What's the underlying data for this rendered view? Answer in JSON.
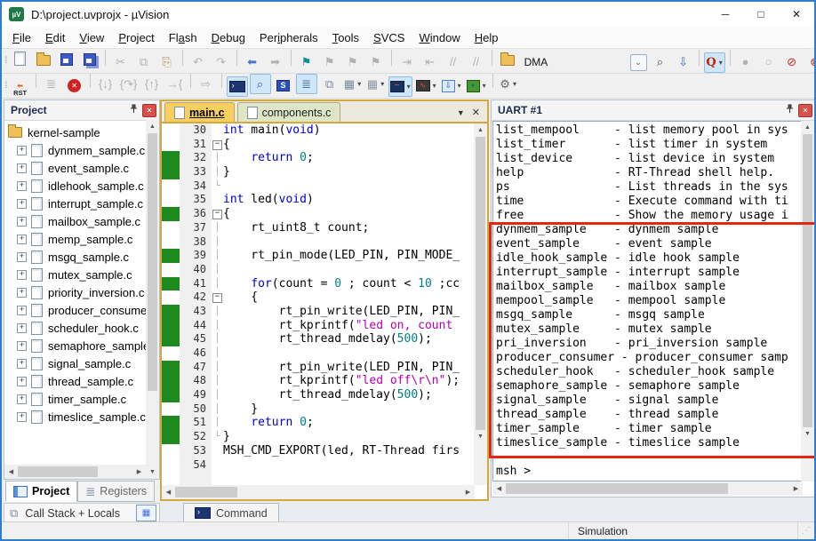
{
  "colors": {
    "window_border": "#2e7dd1",
    "active_tab": "#f6cf5e",
    "inactive_tab": "#dfe6c8",
    "change_bar_green": "#1e8a1e",
    "keyword_blue": "#0000cd",
    "number_teal": "#008080",
    "string_magenta": "#b400b4",
    "annotation_red": "#e62519",
    "close_button_red": "#d8504a",
    "toolbar_highlight": "#cfe6f9"
  },
  "window": {
    "title": "D:\\project.uvprojx - µVision",
    "minimize": "─",
    "maximize": "□",
    "close": "✕",
    "icon_text": "µV"
  },
  "menus": [
    {
      "label": "File",
      "u": 0
    },
    {
      "label": "Edit",
      "u": 0
    },
    {
      "label": "View",
      "u": 0
    },
    {
      "label": "Project",
      "u": 0
    },
    {
      "label": "Flash",
      "u": 2
    },
    {
      "label": "Debug",
      "u": 0
    },
    {
      "label": "Peripherals",
      "u": 3
    },
    {
      "label": "Tools",
      "u": 0
    },
    {
      "label": "SVCS",
      "u": 0
    },
    {
      "label": "Window",
      "u": 0
    },
    {
      "label": "Help",
      "u": 0
    }
  ],
  "toolbar1": [
    {
      "n": "new-file-button",
      "k": "page"
    },
    {
      "n": "open-file-button",
      "k": "folder"
    },
    {
      "n": "save-button",
      "k": "disk"
    },
    {
      "n": "save-all-button",
      "k": "disk2"
    },
    {
      "sep": true
    },
    {
      "n": "cut-button",
      "g": "✂",
      "dim": 1
    },
    {
      "n": "copy-button",
      "g": "⧉",
      "dim": 1
    },
    {
      "n": "paste-button",
      "g": "⎘",
      "c": "#b08d4a"
    },
    {
      "sep": true
    },
    {
      "n": "undo-button",
      "g": "↶",
      "dim": 1
    },
    {
      "n": "redo-button",
      "g": "↷",
      "dim": 1
    },
    {
      "sep": true
    },
    {
      "n": "navigate-back-button",
      "g": "⬅",
      "c": "#4a78c8"
    },
    {
      "n": "navigate-forward-button",
      "g": "➡",
      "dim": 1
    },
    {
      "sep": true
    },
    {
      "n": "toggle-bookmark-button",
      "g": "⚑",
      "c": "#0e8f9a"
    },
    {
      "n": "next-bookmark-button",
      "g": "⚑",
      "dim": 1
    },
    {
      "n": "prev-bookmark-button",
      "g": "⚑",
      "dim": 1
    },
    {
      "n": "clear-bookmarks-button",
      "g": "⚑",
      "dim": 1
    },
    {
      "sep": true
    },
    {
      "n": "indent-button",
      "g": "⇥",
      "dim": 1
    },
    {
      "n": "outdent-button",
      "g": "⇤",
      "dim": 1
    },
    {
      "n": "comment-button",
      "g": "//",
      "dim": 1
    },
    {
      "n": "uncomment-button",
      "g": "//",
      "dim": 1
    },
    {
      "sep": true
    },
    {
      "n": "configure-target-button",
      "k": "folder"
    },
    {
      "combo": "DMA",
      "n": "target-select"
    },
    {
      "n": "find-in-files-button",
      "g": "⌕",
      "c": "#444444"
    },
    {
      "n": "incremental-find-button",
      "g": "⇩",
      "c": "#3a6fd8"
    },
    {
      "sep": true
    },
    {
      "n": "quick-find-button",
      "k": "qicon",
      "g": "Q",
      "on": 1,
      "dd": 1
    },
    {
      "sep": true
    },
    {
      "n": "insert-breakpoint-button",
      "g": "●",
      "dim": 1
    },
    {
      "n": "disable-breakpoint-button",
      "g": "○",
      "dim": 1
    },
    {
      "n": "disable-all-breakpoints-button",
      "g": "⊘",
      "c": "#cc2222"
    },
    {
      "n": "kill-all-breakpoints-button",
      "g": "⊗",
      "c": "#cc2222"
    },
    {
      "sep": true
    },
    {
      "n": "periodic-window-update-button",
      "k": "winicon",
      "on": 1
    }
  ],
  "toolbar2": [
    {
      "n": "reset-button",
      "k": "rst",
      "g": "RST"
    },
    {
      "sep": true
    },
    {
      "n": "flash-download-button",
      "g": "≣",
      "dim": 1
    },
    {
      "n": "stop-debug-button",
      "k": "stop"
    },
    {
      "sep": true
    },
    {
      "n": "step-into-button",
      "g": "{↓}",
      "dim": 1
    },
    {
      "n": "step-over-button",
      "g": "{↷}",
      "dim": 1
    },
    {
      "n": "step-out-button",
      "g": "{↑}",
      "dim": 1
    },
    {
      "n": "run-to-cursor-button",
      "g": "→{",
      "dim": 1
    },
    {
      "sep": true
    },
    {
      "n": "show-next-statement-button",
      "g": "⇨",
      "dim": 1
    },
    {
      "sep": true
    },
    {
      "n": "command-window-button",
      "k": "console",
      "on": 1
    },
    {
      "n": "disassembly-window-button",
      "g": "⌕",
      "c": "#2255aa",
      "on": 1
    },
    {
      "n": "symbol-window-button",
      "k": "sbox",
      "g": "S"
    },
    {
      "n": "registers-window-button",
      "g": "≣",
      "c": "#4a6fa5",
      "on": 1
    },
    {
      "n": "call-stack-window-button",
      "g": "⧉",
      "c": "#7a8aa0"
    },
    {
      "n": "watch-window-button",
      "g": "▦",
      "c": "#7a8aa0",
      "dd": 1
    },
    {
      "n": "memory-window-button",
      "g": "▦",
      "c": "#8a97a8",
      "dd": 1
    },
    {
      "n": "serial-window-button",
      "k": "serial",
      "on": 1,
      "dd": 1
    },
    {
      "n": "analysis-window-button",
      "k": "analyzer",
      "dd": 1
    },
    {
      "n": "system-viewer-button",
      "k": "sysview",
      "dd": 1
    },
    {
      "n": "toolbox-button",
      "k": "board",
      "dd": 1
    },
    {
      "sep": true
    },
    {
      "n": "tools-button",
      "g": "⚙",
      "c": "#666666",
      "dd": 1
    }
  ],
  "project_panel": {
    "title": "Project",
    "tree": [
      {
        "label": "kernel-sample",
        "type": "folder"
      },
      {
        "label": "dynmem_sample.c",
        "type": "file"
      },
      {
        "label": "event_sample.c",
        "type": "file"
      },
      {
        "label": "idlehook_sample.c",
        "type": "file"
      },
      {
        "label": "interrupt_sample.c",
        "type": "file"
      },
      {
        "label": "mailbox_sample.c",
        "type": "file"
      },
      {
        "label": "memp_sample.c",
        "type": "file"
      },
      {
        "label": "msgq_sample.c",
        "type": "file"
      },
      {
        "label": "mutex_sample.c",
        "type": "file"
      },
      {
        "label": "priority_inversion.c",
        "type": "file"
      },
      {
        "label": "producer_consumer.c",
        "type": "file"
      },
      {
        "label": "scheduler_hook.c",
        "type": "file"
      },
      {
        "label": "semaphore_sample.c",
        "type": "file"
      },
      {
        "label": "signal_sample.c",
        "type": "file"
      },
      {
        "label": "thread_sample.c",
        "type": "file"
      },
      {
        "label": "timer_sample.c",
        "type": "file"
      },
      {
        "label": "timeslice_sample.c",
        "type": "file"
      }
    ]
  },
  "editor": {
    "tabs": [
      {
        "label": "main.c"
      },
      {
        "label": "components.c"
      }
    ],
    "lines": [
      {
        "n": 30,
        "g": "",
        "m": 0,
        "t": [
          [
            "k",
            "int"
          ],
          [
            "p",
            " main("
          ],
          [
            "k",
            "void"
          ],
          [
            "p",
            ")"
          ]
        ]
      },
      {
        "n": 31,
        "g": "-",
        "m": 0,
        "t": [
          [
            "p",
            "{"
          ]
        ]
      },
      {
        "n": 32,
        "g": "|",
        "m": 1,
        "t": [
          [
            "p",
            "    "
          ],
          [
            "k",
            "return"
          ],
          [
            "p",
            " "
          ],
          [
            "n",
            "0"
          ],
          [
            "p",
            ";"
          ]
        ]
      },
      {
        "n": 33,
        "g": "|",
        "m": 1,
        "t": [
          [
            "p",
            "}"
          ]
        ]
      },
      {
        "n": 34,
        "g": "L",
        "m": 0,
        "t": []
      },
      {
        "n": 35,
        "g": "",
        "m": 0,
        "t": [
          [
            "k",
            "int"
          ],
          [
            "p",
            " led("
          ],
          [
            "k",
            "void"
          ],
          [
            "p",
            ")"
          ]
        ]
      },
      {
        "n": 36,
        "g": "-",
        "m": 1,
        "t": [
          [
            "p",
            "{"
          ]
        ]
      },
      {
        "n": 37,
        "g": "|",
        "m": 0,
        "t": [
          [
            "p",
            "    rt_uint8_t count;"
          ]
        ]
      },
      {
        "n": 38,
        "g": "|",
        "m": 0,
        "t": []
      },
      {
        "n": 39,
        "g": "|",
        "m": 1,
        "t": [
          [
            "p",
            "    rt_pin_mode(LED_PIN, PIN_MODE_"
          ]
        ]
      },
      {
        "n": 40,
        "g": "|",
        "m": 0,
        "t": []
      },
      {
        "n": 41,
        "g": "|",
        "m": 1,
        "t": [
          [
            "p",
            "    "
          ],
          [
            "k",
            "for"
          ],
          [
            "p",
            "(count = "
          ],
          [
            "n",
            "0"
          ],
          [
            "p",
            " ; count < "
          ],
          [
            "n",
            "10"
          ],
          [
            "p",
            " ;cc"
          ]
        ]
      },
      {
        "n": 42,
        "g": "-",
        "m": 0,
        "t": [
          [
            "p",
            "    {"
          ]
        ]
      },
      {
        "n": 43,
        "g": "|",
        "m": 1,
        "t": [
          [
            "p",
            "        rt_pin_write(LED_PIN, PIN_"
          ]
        ]
      },
      {
        "n": 44,
        "g": "|",
        "m": 1,
        "t": [
          [
            "p",
            "        rt_kprintf("
          ],
          [
            "s",
            "\"led on, count"
          ]
        ]
      },
      {
        "n": 45,
        "g": "|",
        "m": 1,
        "t": [
          [
            "p",
            "        rt_thread_mdelay("
          ],
          [
            "n",
            "500"
          ],
          [
            "p",
            ");"
          ]
        ]
      },
      {
        "n": 46,
        "g": "|",
        "m": 0,
        "t": []
      },
      {
        "n": 47,
        "g": "|",
        "m": 1,
        "t": [
          [
            "p",
            "        rt_pin_write(LED_PIN, PIN_"
          ]
        ]
      },
      {
        "n": 48,
        "g": "|",
        "m": 1,
        "t": [
          [
            "p",
            "        rt_kprintf("
          ],
          [
            "s",
            "\"led off\\r\\n\""
          ],
          [
            "p",
            ");"
          ]
        ]
      },
      {
        "n": 49,
        "g": "|",
        "m": 1,
        "t": [
          [
            "p",
            "        rt_thread_mdelay("
          ],
          [
            "n",
            "500"
          ],
          [
            "p",
            ");"
          ]
        ]
      },
      {
        "n": 50,
        "g": "|",
        "m": 0,
        "t": [
          [
            "p",
            "    }"
          ]
        ]
      },
      {
        "n": 51,
        "g": "|",
        "m": 1,
        "t": [
          [
            "p",
            "    "
          ],
          [
            "k",
            "return"
          ],
          [
            "p",
            " "
          ],
          [
            "n",
            "0"
          ],
          [
            "p",
            ";"
          ]
        ]
      },
      {
        "n": 52,
        "g": "L",
        "m": 1,
        "t": [
          [
            "p",
            "}"
          ]
        ]
      },
      {
        "n": 53,
        "g": "",
        "m": 0,
        "t": [
          [
            "p",
            "MSH_CMD_EXPORT(led, RT-Thread firs"
          ]
        ]
      },
      {
        "n": 54,
        "g": "",
        "m": 0,
        "t": []
      }
    ]
  },
  "uart_panel": {
    "title": "UART #1",
    "lines": [
      "list_mempool     - list memory pool in sys",
      "list_timer       - list timer in system",
      "list_device      - list device in system",
      "help             - RT-Thread shell help.",
      "ps               - List threads in the sys",
      "time             - Execute command with ti",
      "free             - Show the memory usage i",
      "dynmem_sample    - dynmem sample",
      "event_sample     - event sample",
      "idle_hook_sample - idle hook sample",
      "interrupt_sample - interrupt sample",
      "mailbox_sample   - mailbox sample",
      "mempool_sample   - mempool sample",
      "msgq_sample      - msgq sample",
      "mutex_sample     - mutex sample",
      "pri_inversion    - pri_inversion sample",
      "producer_consumer - producer_consumer samp",
      "scheduler_hook   - scheduler_hook sample",
      "semaphore_sample - semaphore sample",
      "signal_sample    - signal sample",
      "thread_sample    - thread sample",
      "timer_sample     - timer sample",
      "timeslice_sample - timeslice sample",
      "",
      "msh >"
    ]
  },
  "bottom": {
    "project_tab": "Project",
    "registers_tab": "Registers",
    "callstack_bar": "Call Stack + Locals",
    "command_tab": "Command"
  },
  "status": {
    "simulation": "Simulation"
  }
}
